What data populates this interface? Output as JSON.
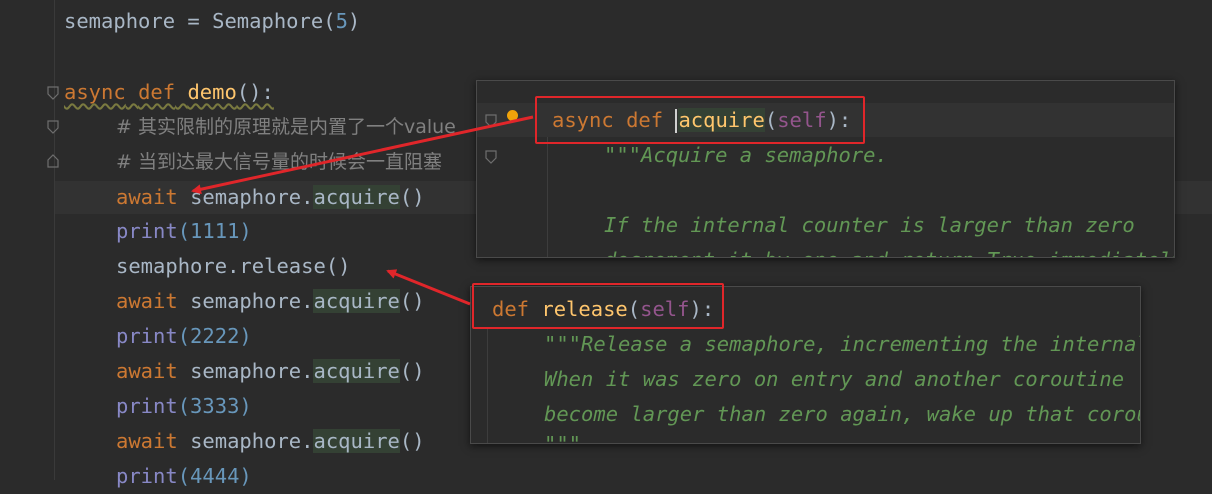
{
  "code": {
    "line1": {
      "name": "semaphore",
      "assign": " = ",
      "cls": "Semaphore",
      "open": "(",
      "num": "5",
      "close": ")"
    },
    "def_line": {
      "kw_async": "async",
      "kw_def": "def",
      "fn": "demo",
      "rest": "():"
    },
    "comment1": "# 其实限制的原理就是内置了一个value",
    "comment2": "# 当到达最大信号量的时候会一直阻塞",
    "await_kw": "await",
    "sem_obj": "semaphore.",
    "acquire": "acquire",
    "call": "()",
    "print_fn": "print",
    "print_values": [
      "(1111)",
      "(2222)",
      "(3333)",
      "(4444)"
    ],
    "release_line": "semaphore.release()"
  },
  "popup_acquire": {
    "kw_async": "async",
    "kw_def": "def",
    "fn": "acquire",
    "open": "(",
    "self": "self",
    "close": "):",
    "doc1": "\"\"\"Acquire a semaphore.",
    "doc2": "If the internal counter is larger than zero",
    "doc3": "decrement it by one and return True immediately"
  },
  "popup_release": {
    "kw_def": "def",
    "fn": "release",
    "open": "(",
    "self": "self",
    "close": "):",
    "doc1": "\"\"\"Release a semaphore, incrementing the internal",
    "doc2": "When it was zero on entry and another coroutine",
    "doc3": "become larger than zero again, wake up that corout",
    "doc4": "\"\"\""
  },
  "colors": {
    "background": "#2b2b2b",
    "keyword": "#cc7832",
    "function": "#ffc66d",
    "number": "#6897bb",
    "builtin": "#8888c6",
    "docstring": "#629755",
    "annotation_red": "#e0262a"
  }
}
